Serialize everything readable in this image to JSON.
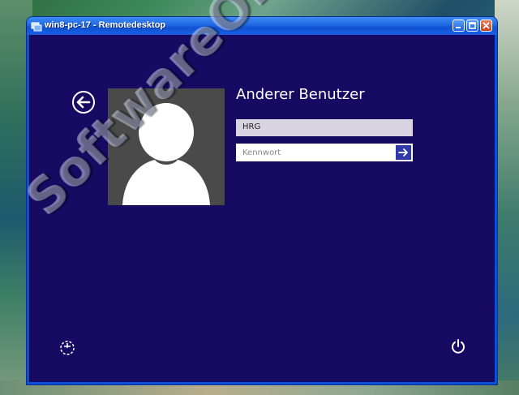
{
  "window": {
    "title": "win8-pc-17 - Remotedesktop"
  },
  "login": {
    "user_name": "Anderer Benutzer",
    "username_value": "HRG",
    "password_placeholder": "Kennwort"
  },
  "icons": {
    "back": "back-arrow-circle-icon",
    "avatar": "user-silhouette-icon",
    "submit": "arrow-right-icon",
    "ease_of_access": "ease-of-access-icon",
    "power": "power-icon"
  },
  "watermark": {
    "text": "SoftwareOK.de"
  },
  "colors": {
    "background": "#170a62",
    "title_bar": "#1f67e0",
    "avatar_tile": "#4a4a4a",
    "submit_button": "#2f3aa6"
  }
}
